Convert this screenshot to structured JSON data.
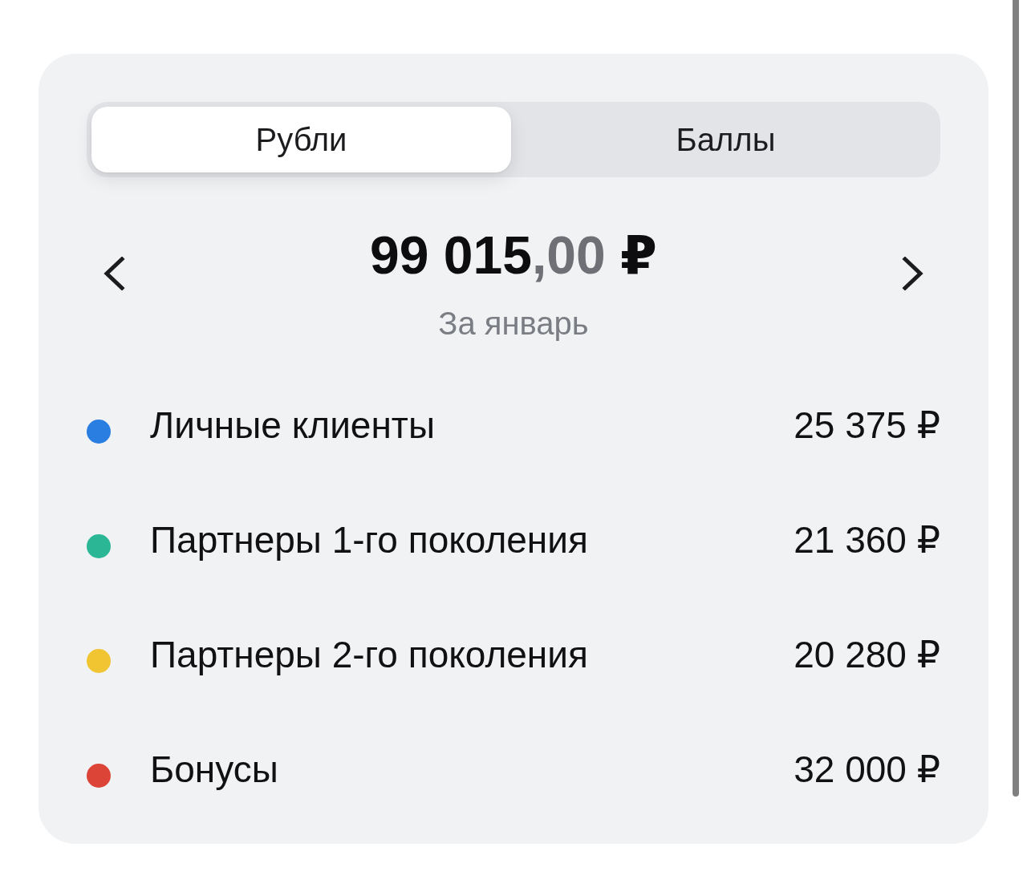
{
  "tabs": [
    {
      "label": "Рубли",
      "selected": true
    },
    {
      "label": "Баллы",
      "selected": false
    }
  ],
  "summary": {
    "amount": "99 015",
    "fraction": ",00",
    "currency": "₽",
    "period": "За январь"
  },
  "breakdown": [
    {
      "label": "Личные клиенты",
      "value": "25 375 ₽",
      "color": "#2a7de1"
    },
    {
      "label": "Партнеры 1-го поколения",
      "value": "21 360 ₽",
      "color": "#2bb795"
    },
    {
      "label": "Партнеры 2-го поколения",
      "value": "20 280 ₽",
      "color": "#f0c531"
    },
    {
      "label": "Бонусы",
      "value": "32 000 ₽",
      "color": "#db4437"
    }
  ]
}
